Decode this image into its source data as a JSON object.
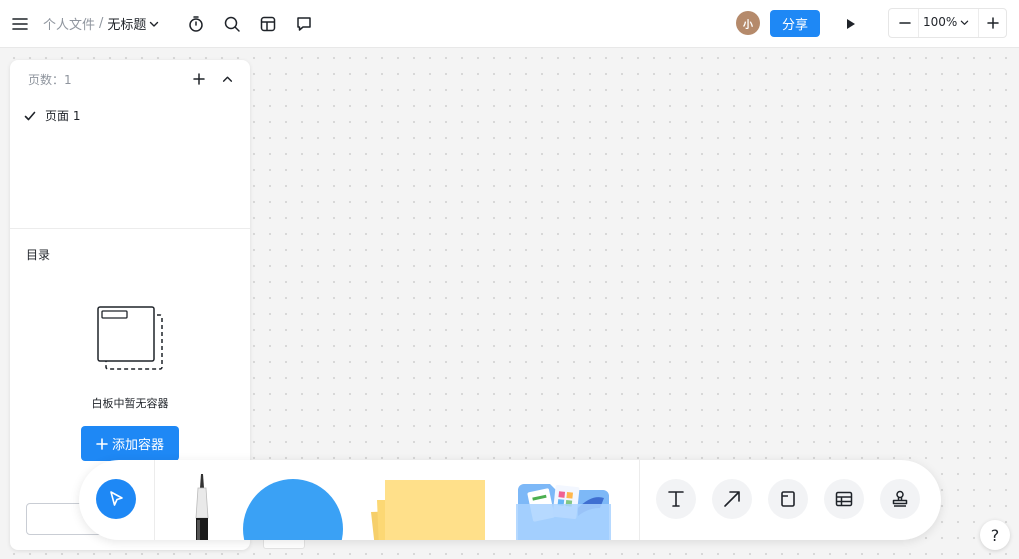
{
  "header": {
    "breadcrumb_parent": "个人文件",
    "breadcrumb_sep": "/",
    "title": "无标题",
    "avatar_text": "小",
    "avatar_color": "#b58a6b",
    "share_label": "分享",
    "zoom_level": "100%"
  },
  "pages_panel": {
    "label": "页数：1",
    "pages": [
      {
        "label": "页面 1",
        "selected": true
      }
    ]
  },
  "toc": {
    "label": "目录",
    "empty_text": "白板中暂无容器",
    "add_button_label": "添加容器"
  },
  "toolbar": {
    "tools": [
      "select-tool",
      "pen-tool",
      "shape-tool",
      "sticky-note-tool",
      "material-folder-tool",
      "text-tool",
      "connector-tool",
      "frame-tool",
      "table-tool",
      "stamp-tool"
    ]
  },
  "help_label": "?",
  "colors": {
    "accent": "#1e88f5",
    "canvas_bg": "#f4f4f4",
    "shape_fill": "#3aa1f5",
    "sticky_fill": "#ffe08a"
  }
}
